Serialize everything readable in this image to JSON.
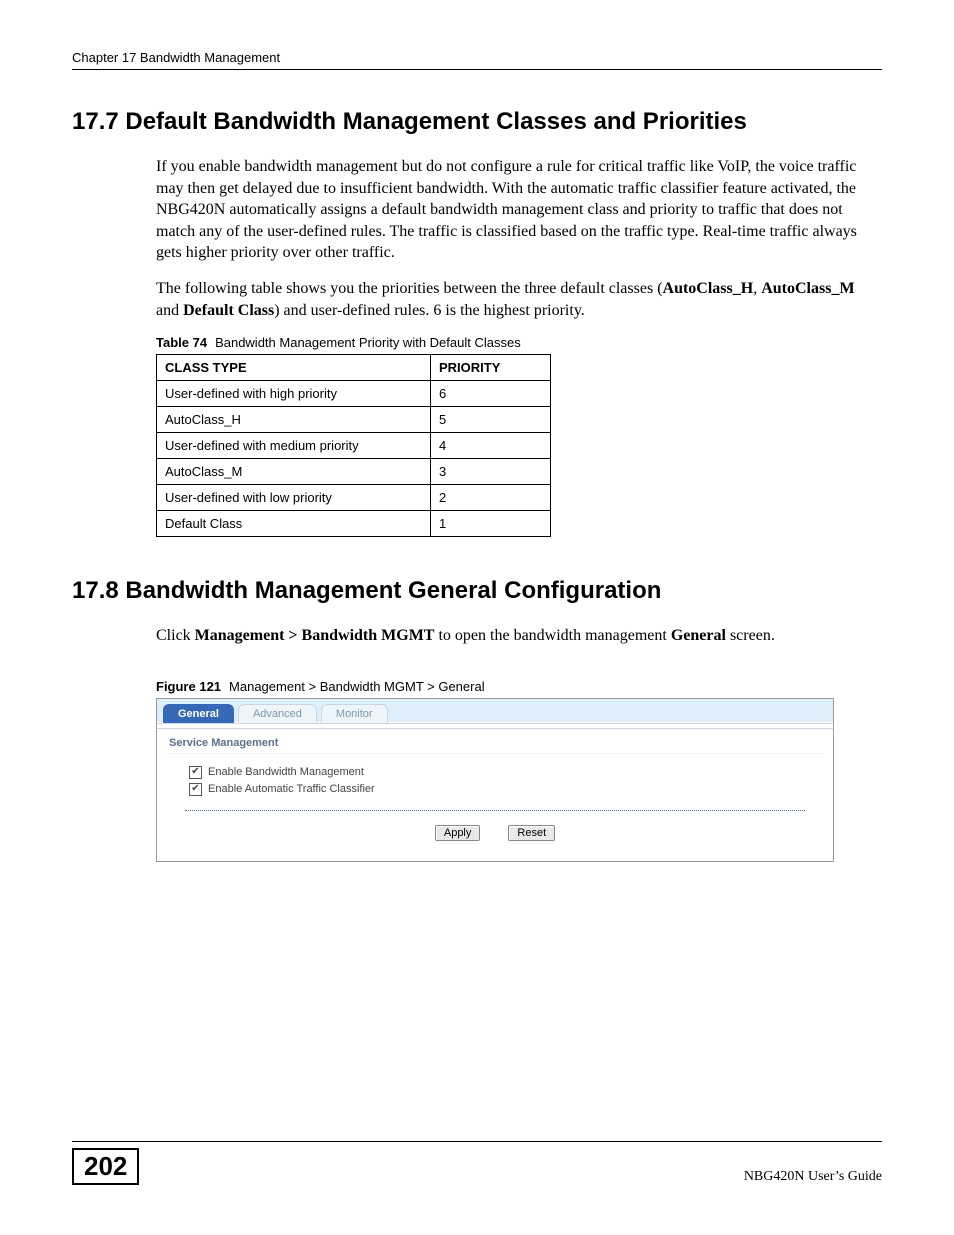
{
  "header": {
    "chapter_line": "Chapter 17 Bandwidth Management"
  },
  "section_17_7": {
    "heading": "17.7  Default Bandwidth Management Classes and Priorities",
    "para1": "If you enable bandwidth management but do not configure a rule for critical traffic like VoIP, the voice traffic may then get delayed due to insufficient bandwidth. With the automatic traffic classifier feature activated, the NBG420N automatically assigns a default bandwidth management class and priority to traffic that does not match any of the user-defined rules. The traffic is classified based on the traffic type. Real-time traffic always gets higher priority over other traffic.",
    "para2_pre": "The following table shows you the priorities between the three default classes (",
    "para2_b1": "AutoClass_H",
    "para2_mid1": ", ",
    "para2_b2": "AutoClass_M",
    "para2_mid2": " and ",
    "para2_b3": "Default Class",
    "para2_post": ") and user-defined rules. 6 is the highest priority.",
    "table_caption_label": "Table 74",
    "table_caption_text": "Bandwidth Management Priority with Default Classes",
    "table_header": {
      "col1": "CLASS TYPE",
      "col2": "PRIORITY"
    },
    "rows": [
      {
        "class_type": "User-defined with high priority",
        "priority": "6"
      },
      {
        "class_type": "AutoClass_H",
        "priority": "5"
      },
      {
        "class_type": "User-defined with medium priority",
        "priority": "4"
      },
      {
        "class_type": "AutoClass_M",
        "priority": "3"
      },
      {
        "class_type": "User-defined with low priority",
        "priority": "2"
      },
      {
        "class_type": "Default Class",
        "priority": "1"
      }
    ]
  },
  "section_17_8": {
    "heading": "17.8  Bandwidth Management General Configuration",
    "para_pre": "Click ",
    "para_b1": "Management > Bandwidth MGMT",
    "para_mid": " to open the bandwidth management ",
    "para_b2": "General",
    "para_post": " screen.",
    "figure_caption_label": "Figure 121",
    "figure_caption_text": "Management > Bandwidth MGMT > General",
    "screenshot": {
      "tabs": {
        "general": "General",
        "advanced": "Advanced",
        "monitor": "Monitor"
      },
      "panel_title": "Service Management",
      "cb1_label": "Enable Bandwidth Management",
      "cb2_label": "Enable Automatic Traffic Classifier",
      "buttons": {
        "apply": "Apply",
        "reset": "Reset"
      }
    }
  },
  "footer": {
    "page_number": "202",
    "guide_name": "NBG420N User’s Guide"
  }
}
